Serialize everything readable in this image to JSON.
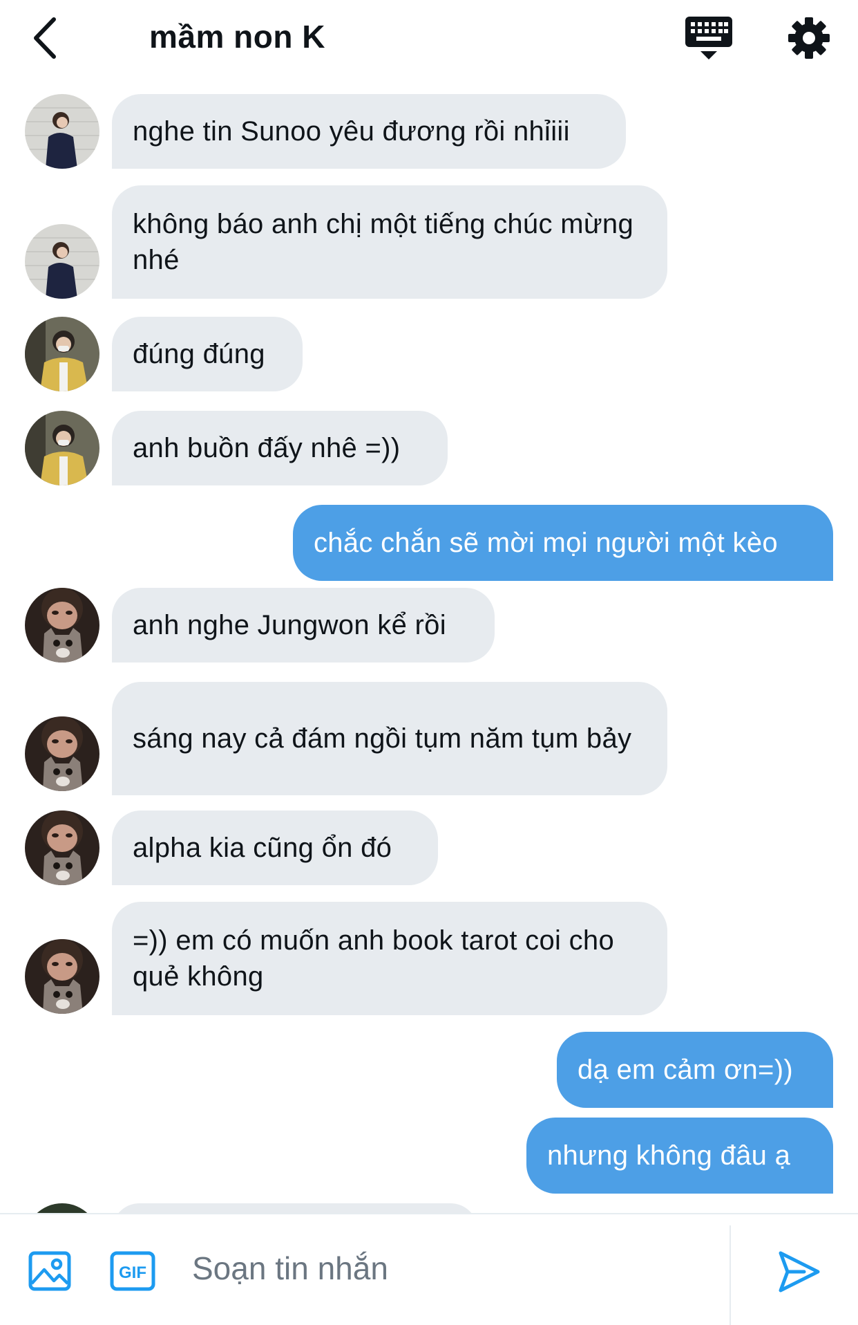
{
  "header": {
    "title": "mầm non K",
    "icons": [
      "back-chevron-icon",
      "keyboard-icon",
      "gear-icon"
    ]
  },
  "messages": [
    {
      "side": "in",
      "avatar": "avatar-girl-white-wall",
      "text": "nghe tin Sunoo yêu đương rồi nhỉiii"
    },
    {
      "side": "in",
      "avatar": "avatar-girl-white-wall",
      "text": "không báo anh chị một tiếng chúc mừng nhé"
    },
    {
      "side": "in",
      "avatar": "avatar-boy-yellow-jacket",
      "text": "đúng đúng"
    },
    {
      "side": "in",
      "avatar": "avatar-boy-yellow-jacket",
      "text": "anh buồn đấy nhê =))"
    },
    {
      "side": "out",
      "text": "chắc chắn sẽ mời mọi người một kèo"
    },
    {
      "side": "in",
      "avatar": "avatar-boy-kitten",
      "text": "anh nghe Jungwon kể rồi"
    },
    {
      "side": "in",
      "avatar": "avatar-boy-kitten",
      "text": "sáng nay cả đám ngồi tụm năm tụm bảy"
    },
    {
      "side": "in",
      "avatar": "avatar-boy-kitten",
      "text": "alpha kia cũng ổn đó"
    },
    {
      "side": "in",
      "avatar": "avatar-boy-kitten",
      "text": "=)) em có muốn anh book tarot coi cho quẻ không"
    },
    {
      "side": "out",
      "text": "dạ em cảm ơn=))"
    },
    {
      "side": "out",
      "text": "nhưng không đâu ạ"
    }
  ],
  "composer": {
    "placeholder": "Soạn tin nhắn",
    "gif_label": "GIF",
    "icons": [
      "image-icon",
      "gif-icon",
      "send-icon"
    ]
  },
  "colors": {
    "accent": "#1d9bf0",
    "outgoing_bubble": "#4d9fe6",
    "incoming_bubble": "#e7ebef"
  }
}
